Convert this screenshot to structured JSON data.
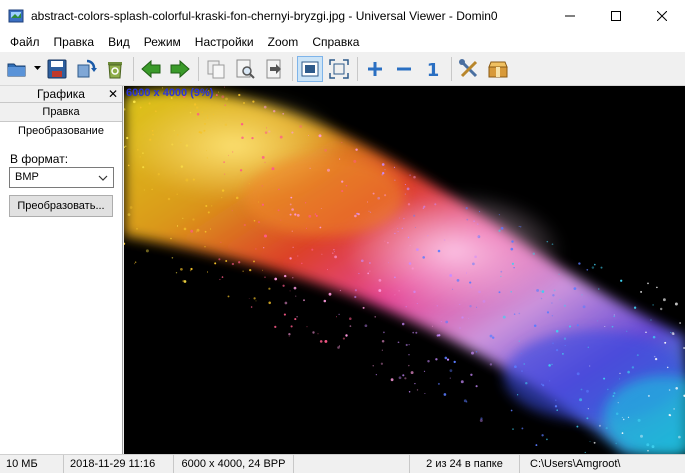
{
  "window": {
    "title": "abstract-colors-splash-colorful-kraski-fon-chernyi-bryzgi.jpg - Universal Viewer - Domin0"
  },
  "menu": {
    "items": [
      "Файл",
      "Правка",
      "Вид",
      "Режим",
      "Настройки",
      "Zoom",
      "Справка"
    ]
  },
  "toolbar": {
    "buttons": [
      {
        "icon": "open-folder-icon"
      },
      {
        "icon": "save-disk-icon"
      },
      {
        "icon": "rotate-refresh-icon"
      },
      {
        "icon": "recycle-bin-icon"
      },
      {
        "icon": "arrow-left-icon"
      },
      {
        "icon": "arrow-right-icon"
      },
      {
        "icon": "copy-icon"
      },
      {
        "icon": "print-preview-icon"
      },
      {
        "icon": "export-icon"
      },
      {
        "icon": "fit-window-icon"
      },
      {
        "icon": "fullscreen-icon"
      },
      {
        "icon": "zoom-in-icon"
      },
      {
        "icon": "zoom-out-icon"
      },
      {
        "icon": "actual-size-icon"
      },
      {
        "icon": "settings-tools-icon"
      },
      {
        "icon": "plugin-box-icon"
      }
    ],
    "zoom_actual_label": "1"
  },
  "sidepanel": {
    "title": "Графика",
    "close_glyph": "✕",
    "tabs": [
      "Правка",
      "Преобразование"
    ],
    "format_label": "В формат:",
    "format_value": "BMP",
    "convert_button": "Преобразовать..."
  },
  "viewport": {
    "image_info": "6000 x 4000 (9%)"
  },
  "statusbar": {
    "file_size": "10 МБ",
    "date": "2018-11-29 11:16",
    "dimensions": "6000 x 4000, 24 BPP",
    "position": "2 из 24 в папке",
    "path": "C:\\Users\\Amgroot\\"
  },
  "colors": {
    "accent": "#0078d7",
    "image_info_text": "#2a34d8"
  }
}
